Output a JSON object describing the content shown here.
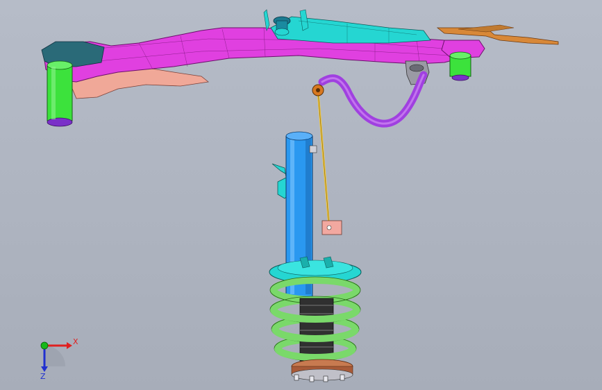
{
  "viewport": {
    "background": "#b1b7c3"
  },
  "triad": {
    "x_label": "X",
    "z_label": "Z",
    "x_color": "#e02020",
    "y_color": "#18b818",
    "z_color": "#2030d0"
  },
  "parts": {
    "subframe_color": "#e040e0",
    "subframe_dark": "#b22cb2",
    "crossmember_color": "#25d6d2",
    "bushing_color": "#3ce23c",
    "bracket_color": "#f2a8a0",
    "stabilizer_bar_color": "#a040e0",
    "stabilizer_link_color": "#f0c840",
    "strut_color": "#2a98f0",
    "spring_color": "#7ad96a",
    "bumper_color": "#303030",
    "plate_color": "#c87a50"
  }
}
